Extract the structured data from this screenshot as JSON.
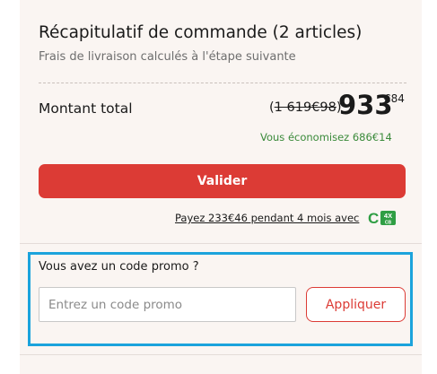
{
  "summary": {
    "title": "Récapitulatif de commande (2 articles)",
    "shipping_note": "Frais de livraison calculés à l'étape suivante"
  },
  "total": {
    "label": "Montant total",
    "old_price_open": "(",
    "old_price": "1 619€98",
    "old_price_close": ")",
    "new_price_integer": "933",
    "new_price_cents": "€84",
    "savings": "Vous économisez 686€14"
  },
  "actions": {
    "validate_label": "Valider"
  },
  "installment": {
    "text": "Payez 233€46 pendant 4 mois avec",
    "logo_letter": "C",
    "logo_badge_top": "4X",
    "logo_badge_bottom": "CB"
  },
  "promo": {
    "question": "Vous avez un code promo ?",
    "input_placeholder": "Entrez un code promo",
    "input_value": "",
    "apply_label": "Appliquer"
  },
  "colors": {
    "accent_red": "#dc3b35",
    "savings_green": "#3a8a3a",
    "highlight_blue": "#1ba3dc",
    "logo_green": "#2f9e44"
  }
}
